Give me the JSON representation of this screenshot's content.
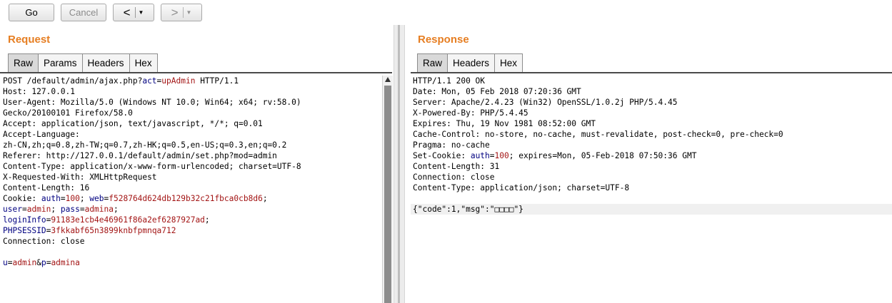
{
  "toolbar": {
    "go_label": "Go",
    "cancel_label": "Cancel",
    "back_arrow": "<",
    "forward_arrow": ">",
    "dropdown_glyph": "▼"
  },
  "request": {
    "title": "Request",
    "tabs": [
      "Raw",
      "Params",
      "Headers",
      "Hex"
    ],
    "lines": [
      [
        [
          "t",
          "POST /default/admin/ajax.php?"
        ],
        [
          "k",
          "act"
        ],
        [
          "t",
          "="
        ],
        [
          "v",
          "upAdmin"
        ],
        [
          "t",
          " HTTP/1.1"
        ]
      ],
      [
        [
          "t",
          "Host: 127.0.0.1"
        ]
      ],
      [
        [
          "t",
          "User-Agent: Mozilla/5.0 (Windows NT 10.0; Win64; x64; rv:58.0)"
        ]
      ],
      [
        [
          "t",
          "Gecko/20100101 Firefox/58.0"
        ]
      ],
      [
        [
          "t",
          "Accept: application/json, text/javascript, */*; q=0.01"
        ]
      ],
      [
        [
          "t",
          "Accept-Language:"
        ]
      ],
      [
        [
          "t",
          "zh-CN,zh;q=0.8,zh-TW;q=0.7,zh-HK;q=0.5,en-US;q=0.3,en;q=0.2"
        ]
      ],
      [
        [
          "t",
          "Referer: http://127.0.0.1/default/admin/set.php?mod=admin"
        ]
      ],
      [
        [
          "t",
          "Content-Type: application/x-www-form-urlencoded; charset=UTF-8"
        ]
      ],
      [
        [
          "t",
          "X-Requested-With: XMLHttpRequest"
        ]
      ],
      [
        [
          "t",
          "Content-Length: 16"
        ]
      ],
      [
        [
          "t",
          "Cookie: "
        ],
        [
          "k",
          "auth"
        ],
        [
          "t",
          "="
        ],
        [
          "v",
          "100"
        ],
        [
          "t",
          "; "
        ],
        [
          "k",
          "web"
        ],
        [
          "t",
          "="
        ],
        [
          "v",
          "f528764d624db129b32c21fbca0cb8d6"
        ],
        [
          "t",
          ";"
        ]
      ],
      [
        [
          "k",
          "user"
        ],
        [
          "t",
          "="
        ],
        [
          "v",
          "admin"
        ],
        [
          "t",
          "; "
        ],
        [
          "k",
          "pass"
        ],
        [
          "t",
          "="
        ],
        [
          "v",
          "admina"
        ],
        [
          "t",
          ";"
        ]
      ],
      [
        [
          "k",
          "loginInfo"
        ],
        [
          "t",
          "="
        ],
        [
          "v",
          "91183e1cb4e46961f86a2ef6287927ad"
        ],
        [
          "t",
          ";"
        ]
      ],
      [
        [
          "k",
          "PHPSESSID"
        ],
        [
          "t",
          "="
        ],
        [
          "v",
          "3fkkabf65n3899knbfpmnqa712"
        ]
      ],
      [
        [
          "t",
          "Connection: close"
        ]
      ],
      [
        [
          "t",
          ""
        ]
      ],
      [
        [
          "k",
          "u"
        ],
        [
          "t",
          "="
        ],
        [
          "v",
          "admin"
        ],
        [
          "t",
          "&"
        ],
        [
          "k",
          "p"
        ],
        [
          "t",
          "="
        ],
        [
          "v",
          "admina"
        ]
      ]
    ]
  },
  "response": {
    "title": "Response",
    "tabs": [
      "Raw",
      "Headers",
      "Hex"
    ],
    "lines": [
      [
        [
          "t",
          "HTTP/1.1 200 OK"
        ]
      ],
      [
        [
          "t",
          "Date: Mon, 05 Feb 2018 07:20:36 GMT"
        ]
      ],
      [
        [
          "t",
          "Server: Apache/2.4.23 (Win32) OpenSSL/1.0.2j PHP/5.4.45"
        ]
      ],
      [
        [
          "t",
          "X-Powered-By: PHP/5.4.45"
        ]
      ],
      [
        [
          "t",
          "Expires: Thu, 19 Nov 1981 08:52:00 GMT"
        ]
      ],
      [
        [
          "t",
          "Cache-Control: no-store, no-cache, must-revalidate, post-check=0, pre-check=0"
        ]
      ],
      [
        [
          "t",
          "Pragma: no-cache"
        ]
      ],
      [
        [
          "t",
          "Set-Cookie: "
        ],
        [
          "k",
          "auth"
        ],
        [
          "t",
          "="
        ],
        [
          "v",
          "100"
        ],
        [
          "t",
          "; expires=Mon, 05-Feb-2018 07:50:36 GMT"
        ]
      ],
      [
        [
          "t",
          "Content-Length: 31"
        ]
      ],
      [
        [
          "t",
          "Connection: close"
        ]
      ],
      [
        [
          "t",
          "Content-Type: application/json; charset=UTF-8"
        ]
      ],
      [
        [
          "t",
          ""
        ]
      ],
      [
        [
          "t",
          "{\"code\":1,\"msg\":\"□□□□\"}"
        ]
      ]
    ],
    "highlighted_line_index": 12
  },
  "colors": {
    "section_title": "#e67e22",
    "param_name": "#000080",
    "param_value": "#a31515"
  }
}
